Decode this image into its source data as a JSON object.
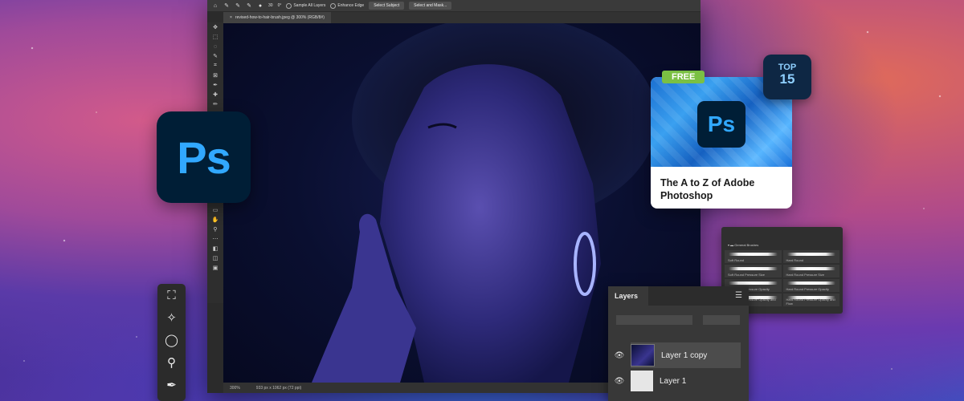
{
  "options_bar": {
    "brush_size": "30",
    "angle": "0°",
    "sample_all_layers": "Sample All Layers",
    "enhance_edge": "Enhance Edge",
    "select_subject": "Select Subject",
    "select_and_mask": "Select and Mask..."
  },
  "document": {
    "tab_title": "revised-how-to-hair-brush.jpeg @ 300% (RGB/8#)",
    "zoom": "300%",
    "size": "933 px x 1062 px (72 ppi)"
  },
  "app_logo": "Ps",
  "course_card": {
    "badge_free": "FREE",
    "rank_label": "TOP",
    "rank_number": "15",
    "logo": "Ps",
    "title": "The A to Z of Adobe Photoshop"
  },
  "brushes_panel": {
    "folder": "General Brushes",
    "items": [
      "Soft Round",
      "Hard Round",
      "Soft Round Pressure Size",
      "Hard Round Pressure Size",
      "Soft Round Pressure Opacity",
      "Hard Round Pressure Opacity",
      "Soft Round Pressure Opacity and Flow",
      "Hard Round Pressure Opacity and Flow"
    ]
  },
  "layers_panel": {
    "title": "Layers",
    "layers": [
      "Layer 1 copy",
      "Layer 1"
    ]
  },
  "colors": {
    "ps_blue": "#31a8ff",
    "ps_navy": "#001e36",
    "free_green": "#7ac043"
  }
}
